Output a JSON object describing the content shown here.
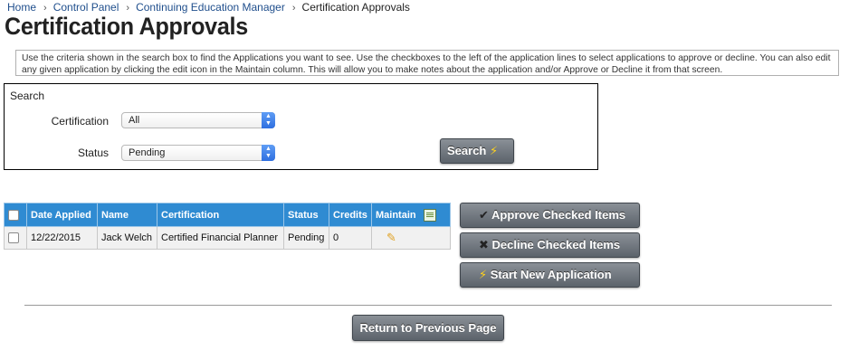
{
  "breadcrumb": {
    "items": [
      "Home",
      "Control Panel",
      "Continuing Education Manager"
    ],
    "current": "Certification Approvals",
    "separator": "›"
  },
  "page": {
    "title": "Certification Approvals",
    "instructions": "Use the criteria shown in the search box to find the Applications you want to see. Use the checkboxes to the left of the application lines to select applications to approve or decline. You can also edit any given application by clicking the edit icon in the Maintain column. This will allow you to make notes about the application and/or Approve or Decline it from that screen."
  },
  "search": {
    "title": "Search",
    "certification_label": "Certification",
    "certification_value": "All",
    "status_label": "Status",
    "status_value": "Pending",
    "button_label": "Search"
  },
  "table": {
    "columns": [
      "Date Applied",
      "Name",
      "Certification",
      "Status",
      "Credits",
      "Maintain"
    ],
    "rows": [
      {
        "date_applied": "12/22/2015",
        "name": "Jack Welch",
        "certification": "Certified Financial Planner",
        "status": "Pending",
        "credits": "0"
      }
    ]
  },
  "actions": {
    "approve": "Approve Checked Items",
    "decline": "Decline Checked Items",
    "start_new": "Start New Application",
    "return": "Return to Previous Page"
  },
  "icons": {
    "approve": "checkmark-icon",
    "decline": "x-icon",
    "start_new": "lightning-icon",
    "search": "lightning-icon",
    "edit": "pencil-icon",
    "maintain": "spreadsheet-icon"
  },
  "colors": {
    "table_header": "#2f8bd2",
    "button": "#6b7179",
    "bolt": "#ffd21c",
    "link": "#1f4e8c"
  }
}
